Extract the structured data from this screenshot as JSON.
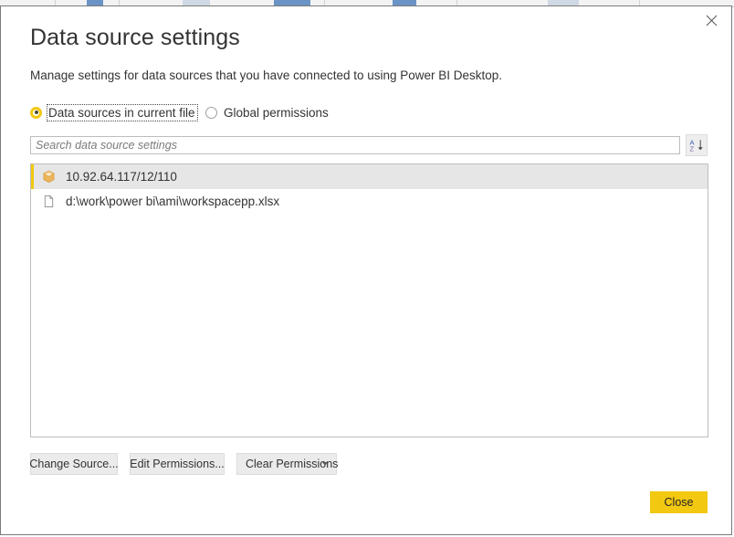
{
  "dialog": {
    "title": "Data source settings",
    "subtitle": "Manage settings for data sources that you have connected to using Power BI Desktop.",
    "close_icon": "close-x-icon"
  },
  "scope": {
    "options": [
      {
        "label": "Data sources in current file",
        "selected": true,
        "focused": true
      },
      {
        "label": "Global permissions",
        "selected": false,
        "focused": false
      }
    ]
  },
  "search": {
    "placeholder": "Search data source settings",
    "value": "",
    "sort_icon": "sort-az-icon",
    "sort_tooltip": "Sort A to Z"
  },
  "list": {
    "items": [
      {
        "label": "10.92.64.117/12/110",
        "icon": "database-cube-icon",
        "selected": true
      },
      {
        "label": "d:\\work\\power bi\\ami\\workspacepp.xlsx",
        "icon": "file-document-icon",
        "selected": false
      }
    ]
  },
  "actions": {
    "change_source": "Change Source...",
    "edit_permissions": "Edit Permissions...",
    "clear_permissions": "Clear Permissions",
    "clear_permissions_caret": "chevron-down-icon",
    "close": "Close"
  },
  "colors": {
    "accent_yellow": "#f2c811",
    "selection_gray": "#e6e6e6",
    "text": "#333333",
    "cube_icon": "#e8a33d",
    "dialog_border": "#7a7a7a"
  }
}
